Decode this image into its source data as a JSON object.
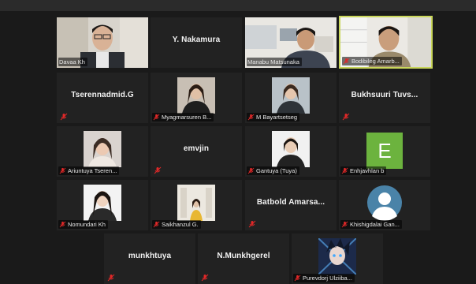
{
  "participants": [
    {
      "name": "Davaa Kh",
      "display": "video"
    },
    {
      "name": "Y. Nakamura",
      "display": "name"
    },
    {
      "name": "Manabu Matsunaka",
      "display": "video"
    },
    {
      "name": "Bodibileg Amarb...",
      "display": "video",
      "active": true
    },
    {
      "name": "Tserennadmid.G",
      "display": "name"
    },
    {
      "name": "Myagmarsuren B...",
      "display": "photo"
    },
    {
      "name": "M Bayartsetseg",
      "display": "photo"
    },
    {
      "name": "Bukhsuuri Tuvs...",
      "display": "name"
    },
    {
      "name": "Ariuntuya Tseren...",
      "display": "video"
    },
    {
      "name": "emvjin",
      "display": "name"
    },
    {
      "name": "Gantuya (Tuya)",
      "display": "photo"
    },
    {
      "name": "Enhjavhlan b",
      "display": "letter",
      "letter": "E",
      "letter_color": "#6cb33e"
    },
    {
      "name": "Nomundari Kh",
      "display": "photo"
    },
    {
      "name": "Saikhanzul G.",
      "display": "photo"
    },
    {
      "name": "Batbold Amarsa...",
      "display": "name"
    },
    {
      "name": "Khishigdalai Gan...",
      "display": "photo"
    },
    {
      "name": "munkhtuya",
      "display": "name"
    },
    {
      "name": "N.Munkhgerel",
      "display": "name"
    },
    {
      "name": "Purevdorj Ulziiba...",
      "display": "photo"
    }
  ],
  "colors": {
    "background": "#1a1a1a",
    "tile": "#222222",
    "active_border": "#c9d65b",
    "muted_icon": "#e02828"
  },
  "icons": {
    "muted": "microphone-muted-icon"
  }
}
